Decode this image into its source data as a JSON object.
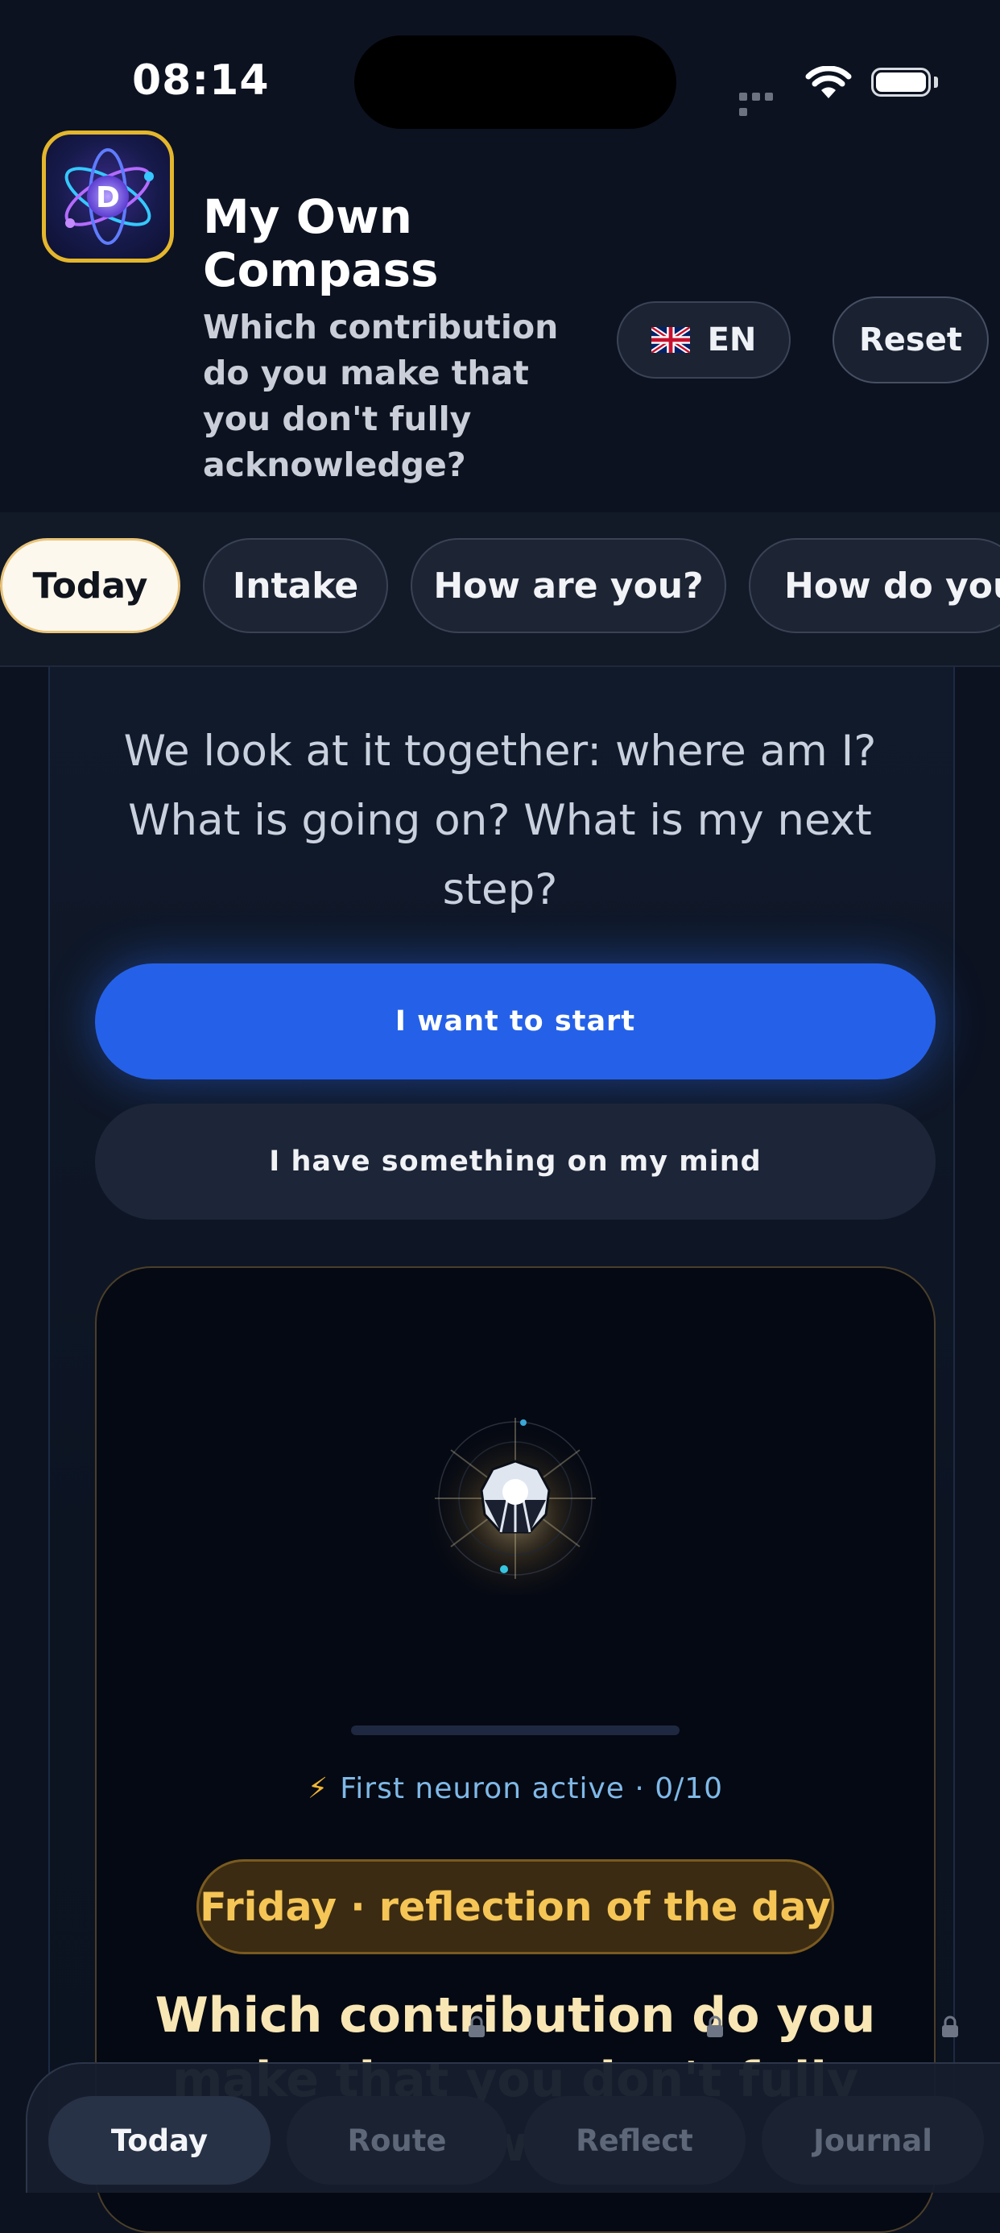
{
  "status_bar": {
    "time": "08:14"
  },
  "header": {
    "title": "My Own Compass",
    "subtitle": "Which contribution do you make that you don't fully acknowledge?",
    "language_label": "EN",
    "reset_label": "Reset"
  },
  "tabs": [
    {
      "label": "Today",
      "active": true
    },
    {
      "label": "Intake",
      "active": false
    },
    {
      "label": "How are you?",
      "active": false
    },
    {
      "label": "How do you",
      "active": false
    }
  ],
  "main": {
    "intro_text": "We look at it together: where am I? What is going on? What is my next step?",
    "start_button": "I want to start",
    "mind_button": "I have something on my mind",
    "neuron_status": "First neuron active · 0/10",
    "neuron_progress": 0,
    "reflection_badge": "Friday · reflection of the day",
    "daily_question": "Which contribution do you make that you don't fully acknowledge?"
  },
  "bottom_nav": [
    {
      "label": "Today",
      "active": true,
      "locked": false
    },
    {
      "label": "Route",
      "active": false,
      "locked": true
    },
    {
      "label": "Reflect",
      "active": false,
      "locked": true
    },
    {
      "label": "Journal",
      "active": false,
      "locked": true
    }
  ],
  "colors": {
    "background": "#0c1220",
    "primary_button": "#2561e8",
    "gold_accent": "#f5c556",
    "logo_border": "#e4b62c"
  },
  "icons": [
    "wifi-icon",
    "battery-icon",
    "uk-flag-icon",
    "atom-logo-icon",
    "neuron-orb-icon",
    "lightning-icon",
    "lock-icon"
  ]
}
